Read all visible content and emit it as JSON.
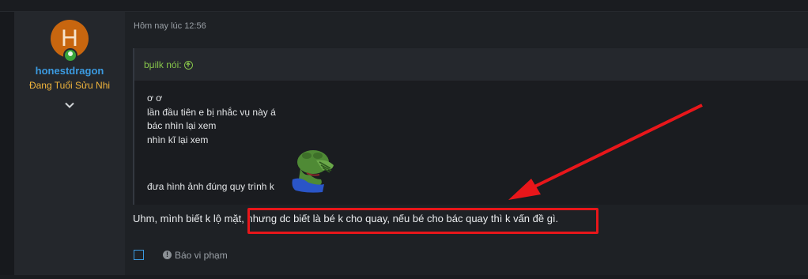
{
  "post": {
    "timestamp": "Hôm nay lúc 12:56",
    "author": {
      "avatar_letter": "H",
      "username": "honestdragon",
      "user_title": "Đang Tuổi Sửu Nhi"
    },
    "quote": {
      "attribution": "bμilk nói:",
      "lines": [
        "ơ ơ",
        "lần đầu tiên e bị nhắc vụ này á",
        "bác nhìn lại xem",
        "nhìn kĩ lại xem"
      ],
      "last_line": "đưa hình ảnh đúng quy trình k"
    },
    "reply_text": "Uhm, mình biết k lộ mặt, nhưng dc biết là bé k cho quay, nếu bé cho bác quay thì k vấn đề gì.",
    "report_label": "Báo vi phạm"
  },
  "colors": {
    "annotation_red": "#e8161a",
    "username_blue": "#3b9ae0",
    "title_gold": "#f0b43c",
    "quote_green": "#86c34a"
  }
}
